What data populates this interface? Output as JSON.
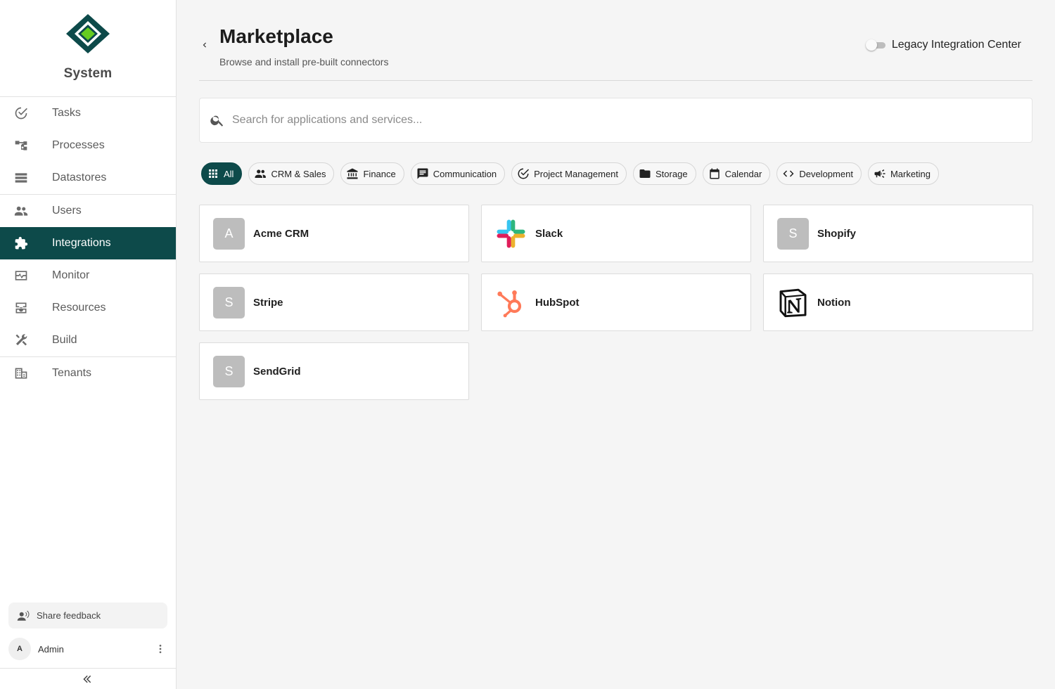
{
  "app": {
    "name": "System",
    "accent_color": "#0d4a4a",
    "logo": "diamond-logo"
  },
  "sidebar": {
    "groups": [
      [
        {
          "label": "Tasks",
          "icon": "check-circle-icon",
          "active": false
        },
        {
          "label": "Processes",
          "icon": "process-tree-icon",
          "active": false
        },
        {
          "label": "Datastores",
          "icon": "list-storage-icon",
          "active": false
        }
      ],
      [
        {
          "label": "Users",
          "icon": "users-icon",
          "active": false
        },
        {
          "label": "Integrations",
          "icon": "puzzle-icon",
          "active": true
        },
        {
          "label": "Monitor",
          "icon": "monitor-pulse-icon",
          "active": false
        },
        {
          "label": "Resources",
          "icon": "inbox-tray-icon",
          "active": false
        },
        {
          "label": "Build",
          "icon": "tools-icon",
          "active": false
        }
      ],
      [
        {
          "label": "Tenants",
          "icon": "building-icon",
          "active": false
        }
      ]
    ],
    "feedback_label": "Share feedback",
    "user": {
      "initial": "A",
      "name": "Admin"
    }
  },
  "header": {
    "title": "Marketplace",
    "subtitle": "Browse and install pre-built connectors",
    "legacy_toggle": {
      "label": "Legacy Integration Center",
      "enabled": false
    }
  },
  "search": {
    "placeholder": "Search for applications and services...",
    "value": ""
  },
  "categories": [
    {
      "label": "All",
      "icon": "grid-icon",
      "active": true
    },
    {
      "label": "CRM & Sales",
      "icon": "people-icon",
      "active": false
    },
    {
      "label": "Finance",
      "icon": "bank-icon",
      "active": false
    },
    {
      "label": "Communication",
      "icon": "chat-icon",
      "active": false
    },
    {
      "label": "Project Management",
      "icon": "check-circle-icon",
      "active": false
    },
    {
      "label": "Storage",
      "icon": "folder-icon",
      "active": false
    },
    {
      "label": "Calendar",
      "icon": "calendar-icon",
      "active": false
    },
    {
      "label": "Development",
      "icon": "code-icon",
      "active": false
    },
    {
      "label": "Marketing",
      "icon": "megaphone-icon",
      "active": false
    }
  ],
  "connectors": [
    {
      "name": "Acme CRM",
      "logo": "letter",
      "initial": "A"
    },
    {
      "name": "Slack",
      "logo": "slack-logo"
    },
    {
      "name": "Shopify",
      "logo": "letter",
      "initial": "S"
    },
    {
      "name": "Stripe",
      "logo": "letter",
      "initial": "S"
    },
    {
      "name": "HubSpot",
      "logo": "hubspot-logo"
    },
    {
      "name": "Notion",
      "logo": "notion-logo"
    },
    {
      "name": "SendGrid",
      "logo": "letter",
      "initial": "S"
    }
  ]
}
